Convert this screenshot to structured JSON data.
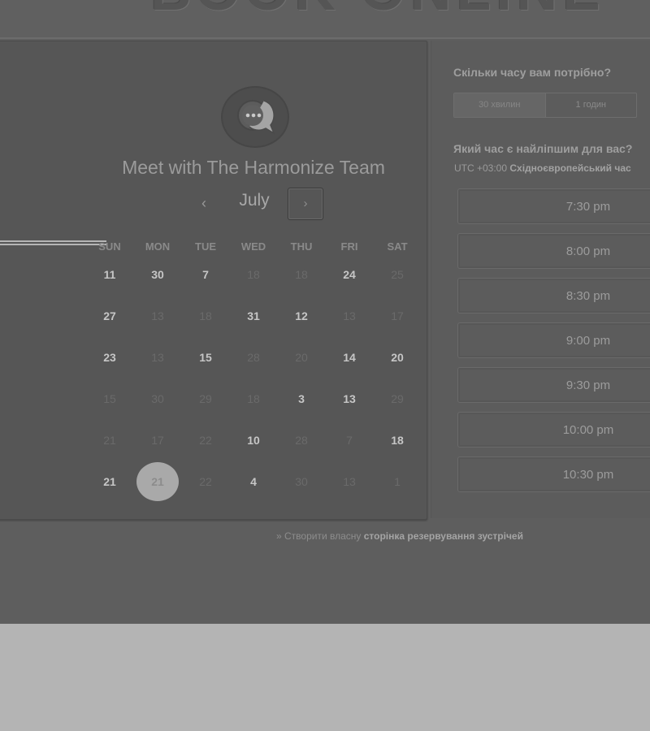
{
  "logo": {
    "text": "BOOK ONLINE"
  },
  "host": {
    "name": "Meet with The Harmonize Team"
  },
  "calendar": {
    "month": "July",
    "prev_icon": "‹",
    "next_icon": "›",
    "weekdays": [
      "SUN",
      "MON",
      "TUE",
      "WED",
      "THU",
      "FRI",
      "SAT"
    ],
    "weeks": [
      [
        {
          "d": "11",
          "s": "active"
        },
        {
          "d": "30",
          "s": "active"
        },
        {
          "d": "7",
          "s": "active"
        },
        {
          "d": "18",
          "s": "muted"
        },
        {
          "d": "18",
          "s": "muted"
        },
        {
          "d": "24",
          "s": "active"
        },
        {
          "d": "25",
          "s": "muted"
        }
      ],
      [
        {
          "d": "27",
          "s": "active"
        },
        {
          "d": "13",
          "s": "muted"
        },
        {
          "d": "18",
          "s": "muted"
        },
        {
          "d": "31",
          "s": "active"
        },
        {
          "d": "12",
          "s": "active"
        },
        {
          "d": "13",
          "s": "muted"
        },
        {
          "d": "17",
          "s": "muted"
        }
      ],
      [
        {
          "d": "23",
          "s": "active"
        },
        {
          "d": "13",
          "s": "muted"
        },
        {
          "d": "15",
          "s": "active"
        },
        {
          "d": "28",
          "s": "muted"
        },
        {
          "d": "20",
          "s": "muted"
        },
        {
          "d": "14",
          "s": "active"
        },
        {
          "d": "20",
          "s": "active"
        }
      ],
      [
        {
          "d": "15",
          "s": "muted"
        },
        {
          "d": "30",
          "s": "muted"
        },
        {
          "d": "29",
          "s": "muted"
        },
        {
          "d": "18",
          "s": "muted"
        },
        {
          "d": "3",
          "s": "active"
        },
        {
          "d": "13",
          "s": "active"
        },
        {
          "d": "29",
          "s": "muted"
        }
      ],
      [
        {
          "d": "21",
          "s": "muted"
        },
        {
          "d": "17",
          "s": "muted"
        },
        {
          "d": "22",
          "s": "muted"
        },
        {
          "d": "10",
          "s": "active"
        },
        {
          "d": "28",
          "s": "muted"
        },
        {
          "d": "7",
          "s": "muted"
        },
        {
          "d": "18",
          "s": "active"
        }
      ],
      [
        {
          "d": "21",
          "s": "active"
        },
        {
          "d": "21",
          "s": "selected"
        },
        {
          "d": "22",
          "s": "muted"
        },
        {
          "d": "4",
          "s": "active"
        },
        {
          "d": "30",
          "s": "muted"
        },
        {
          "d": "13",
          "s": "muted"
        },
        {
          "d": "1",
          "s": "muted"
        }
      ]
    ]
  },
  "duration": {
    "question": "Скільки часу вам потрібно?",
    "options": [
      "30 хвилин",
      "1 годин"
    ],
    "selected_index": 0
  },
  "time": {
    "question": "Який час є найліпшим для вас?",
    "timezone_prefix": "UTC +03:00",
    "timezone_name": "Східноєвропейський час",
    "slots": [
      "7:30 pm",
      "8:00 pm",
      "8:30 pm",
      "9:00 pm",
      "9:30 pm",
      "10:00 pm",
      "10:30 pm"
    ]
  },
  "footer": {
    "prefix": "» Створити власну",
    "link": "сторінка резервування зустрічей"
  }
}
